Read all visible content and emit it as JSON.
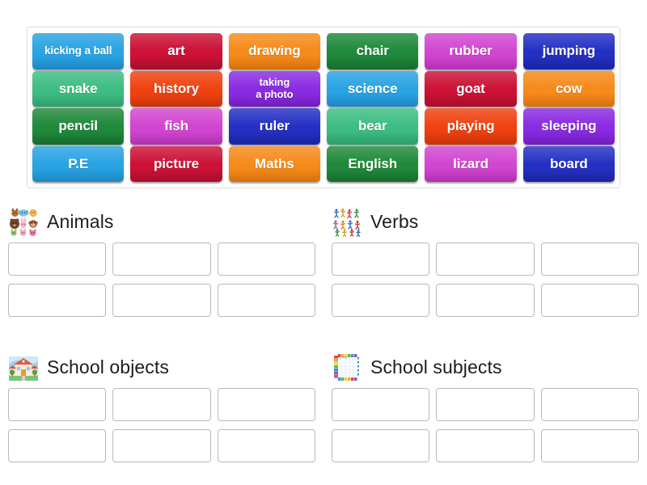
{
  "activity": {
    "type": "group-sort",
    "background_color": "#ffffff"
  },
  "word_bank": {
    "name": "word-bank",
    "tiles": [
      {
        "label": "kicking a ball",
        "color": "#29a3e3",
        "shade": "#1d86bf",
        "text_color": "#ffffff",
        "size": "small"
      },
      {
        "label": "art",
        "color": "#cc1236",
        "shade": "#a50d2b",
        "text_color": "#ffffff",
        "size": "normal"
      },
      {
        "label": "drawing",
        "color": "#f68a1a",
        "shade": "#d3710c",
        "text_color": "#ffffff",
        "size": "normal"
      },
      {
        "label": "chair",
        "color": "#1f8a3b",
        "shade": "#166b2d",
        "text_color": "#ffffff",
        "size": "normal"
      },
      {
        "label": "rubber",
        "color": "#d146d1",
        "shade": "#b02fb0",
        "text_color": "#ffffff",
        "size": "normal"
      },
      {
        "label": "jumping",
        "color": "#2430c4",
        "shade": "#1a249c",
        "text_color": "#ffffff",
        "size": "normal"
      },
      {
        "label": "snake",
        "color": "#3dbd83",
        "shade": "#2e9d69",
        "text_color": "#ffffff",
        "size": "normal"
      },
      {
        "label": "history",
        "color": "#ef4210",
        "shade": "#c7330a",
        "text_color": "#ffffff",
        "size": "normal"
      },
      {
        "label": "taking\na photo",
        "color": "#8a2be2",
        "shade": "#6f1dbb",
        "text_color": "#ffffff",
        "size": "two-line"
      },
      {
        "label": "science",
        "color": "#29a3e3",
        "shade": "#1d86bf",
        "text_color": "#ffffff",
        "size": "normal"
      },
      {
        "label": "goat",
        "color": "#cc1236",
        "shade": "#a50d2b",
        "text_color": "#ffffff",
        "size": "normal"
      },
      {
        "label": "cow",
        "color": "#f68a1a",
        "shade": "#d3710c",
        "text_color": "#ffffff",
        "size": "normal"
      },
      {
        "label": "pencil",
        "color": "#1f8a3b",
        "shade": "#166b2d",
        "text_color": "#ffffff",
        "size": "normal"
      },
      {
        "label": "fish",
        "color": "#d146d1",
        "shade": "#b02fb0",
        "text_color": "#ffffff",
        "size": "normal"
      },
      {
        "label": "ruler",
        "color": "#2430c4",
        "shade": "#1a249c",
        "text_color": "#ffffff",
        "size": "normal"
      },
      {
        "label": "bear",
        "color": "#3dbd83",
        "shade": "#2e9d69",
        "text_color": "#ffffff",
        "size": "normal"
      },
      {
        "label": "playing",
        "color": "#ef4210",
        "shade": "#c7330a",
        "text_color": "#ffffff",
        "size": "normal"
      },
      {
        "label": "sleeping",
        "color": "#8a2be2",
        "shade": "#6f1dbb",
        "text_color": "#ffffff",
        "size": "normal"
      },
      {
        "label": "P.E",
        "color": "#29a3e3",
        "shade": "#1d86bf",
        "text_color": "#ffffff",
        "size": "normal"
      },
      {
        "label": "picture",
        "color": "#cc1236",
        "shade": "#a50d2b",
        "text_color": "#ffffff",
        "size": "normal"
      },
      {
        "label": "Maths",
        "color": "#f68a1a",
        "shade": "#d3710c",
        "text_color": "#ffffff",
        "size": "normal"
      },
      {
        "label": "English",
        "color": "#1f8a3b",
        "shade": "#166b2d",
        "text_color": "#ffffff",
        "size": "normal"
      },
      {
        "label": "lizard",
        "color": "#d146d1",
        "shade": "#b02fb0",
        "text_color": "#ffffff",
        "size": "normal"
      },
      {
        "label": "board",
        "color": "#2430c4",
        "shade": "#1a249c",
        "text_color": "#ffffff",
        "size": "normal"
      }
    ]
  },
  "categories": [
    {
      "title": "Animals",
      "icon": "animals-collage-icon",
      "drop_slots": 6,
      "slot_values": [
        "",
        "",
        "",
        "",
        "",
        ""
      ]
    },
    {
      "title": "Verbs",
      "icon": "people-actions-icon",
      "drop_slots": 6,
      "slot_values": [
        "",
        "",
        "",
        "",
        "",
        ""
      ]
    },
    {
      "title": "School objects",
      "icon": "school-building-icon",
      "drop_slots": 6,
      "slot_values": [
        "",
        "",
        "",
        "",
        "",
        ""
      ]
    },
    {
      "title": "School subjects",
      "icon": "notebook-grid-icon",
      "drop_slots": 6,
      "slot_values": [
        "",
        "",
        "",
        "",
        "",
        ""
      ]
    }
  ]
}
